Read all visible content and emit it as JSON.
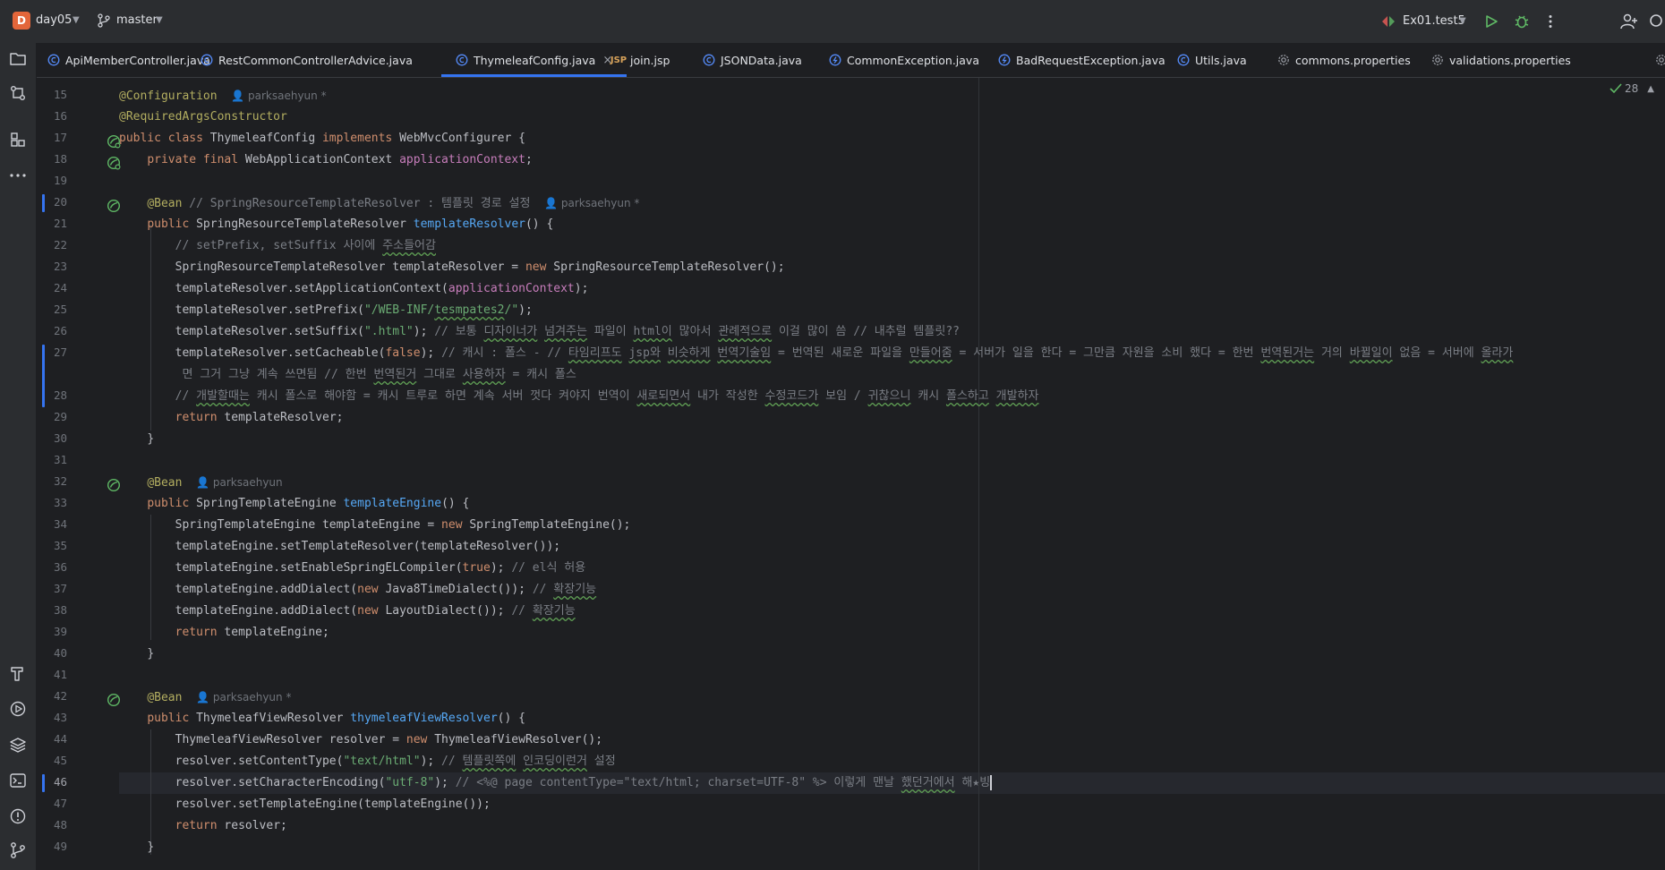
{
  "titlebar": {
    "project_initial": "D",
    "project_name": "day05",
    "branch": "master",
    "run_config": "Ex01.test5",
    "colors": {
      "accent": "#3574f0",
      "badge": "#e3663a",
      "run": "#5fb865"
    }
  },
  "left_toolbar": {
    "icons": [
      "folder-icon",
      "commit-icon",
      "structure-icon",
      "more-icon",
      "build-icon",
      "run-icon",
      "layers-icon",
      "terminal-icon",
      "problems-icon",
      "git-icon"
    ]
  },
  "tabs": [
    {
      "label": "ApiMemberController.java",
      "icon": "java-class-icon"
    },
    {
      "label": "RestCommonControllerAdvice.java",
      "icon": "java-class-icon"
    },
    {
      "label": "ThymeleafConfig.java",
      "icon": "java-class-icon",
      "active": true
    },
    {
      "label": "join.jsp",
      "icon": "jsp-icon"
    },
    {
      "label": "JSONData.java",
      "icon": "java-class-icon"
    },
    {
      "label": "CommonException.java",
      "icon": "exception-icon"
    },
    {
      "label": "BadRequestException.java",
      "icon": "exception-icon"
    },
    {
      "label": "Utils.java",
      "icon": "java-class-icon"
    },
    {
      "label": "commons.properties",
      "icon": "settings-icon"
    },
    {
      "label": "validations.properties",
      "icon": "settings-icon"
    }
  ],
  "tab_close_glyph": "×",
  "inspection": {
    "count": "28"
  },
  "gutter": {
    "line_numbers": [
      "15",
      "16",
      "17",
      "18",
      "19",
      "20",
      "21",
      "22",
      "23",
      "24",
      "25",
      "26",
      "27",
      "",
      "28",
      "29",
      "30",
      "31",
      "32",
      "33",
      "34",
      "35",
      "36",
      "37",
      "38",
      "39",
      "40",
      "41",
      "42",
      "43",
      "44",
      "45",
      "46",
      "47",
      "48",
      "49"
    ]
  },
  "code": {
    "l15_ann": "@Configuration",
    "l15_author": "parksaehyun *",
    "l16_ann": "@RequiredArgsConstructor",
    "l17_a": "public class ",
    "l17_b": "ThymeleafConfig ",
    "l17_c": "implements ",
    "l17_d": "WebMvcConfigurer {",
    "l18_a": "private final ",
    "l18_b": "WebApplicationContext ",
    "l18_c": "applicationContext",
    "l18_d": ";",
    "l20_ann": "@Bean",
    "l20_cm": " // SpringResourceTemplateResolver : 템플릿 경로 설정",
    "l20_author": "parksaehyun *",
    "l21_a": "public ",
    "l21_b": "SpringResourceTemplateResolver ",
    "l21_c": "templateResolver",
    "l21_d": "() {",
    "l22_cm1": "// setPrefix, setSuffix 사이에 ",
    "l22_cm2": "주소들어감",
    "l23_a": "SpringResourceTemplateResolver templateResolver = ",
    "l23_b": "new ",
    "l23_c": "SpringResourceTemplateResolver();",
    "l24_a": "templateResolver.setApplicationContext(",
    "l24_b": "applicationContext",
    "l24_c": ");",
    "l25_a": "templateResolver.setPrefix(",
    "l25_b": "\"/WEB-INF/",
    "l25_c": "tesmpates2",
    "l25_d": "/\"",
    "l25_e": ");",
    "l26_a": "templateResolver.setSuffix(",
    "l26_b": "\".html\"",
    "l26_c": "); ",
    "l26_d": "// 보통 ",
    "l26_e": "디자이너가",
    "l26_f": " ",
    "l26_g": "넘겨주는",
    "l26_h": " 파일이 ",
    "l26_i": "html이",
    "l26_j": " 많아서 ",
    "l26_k": "관례적으로",
    "l26_l": " 이걸 많이 씀 // 내추럴 템플릿??",
    "l27_a": "templateResolver.setCacheable(",
    "l27_b": "false",
    "l27_c": "); ",
    "l27_d": "// 캐시 : 폴스 - // ",
    "l27_e": "타임리프도",
    "l27_f": " ",
    "l27_g": "jsp와",
    "l27_h": " ",
    "l27_i": "비슷하게",
    "l27_j": " ",
    "l27_k": "번역기술임",
    "l27_l": " = 번역된 새로운 파일을 ",
    "l27_m": "만들어줌",
    "l27_n": " = 서버가 일을 한다 = 그만큼 자원을 소비 했다 = 한번 ",
    "l27_o": "번역된거는",
    "l27_p": " 거의 ",
    "l27_q": "바뀔일이",
    "l27_r": " 없음 = 서버에 ",
    "l27_s": "올라가",
    "l27w_a": " 면 그거 그냥 계속 쓰면됨 // 한번 ",
    "l27w_b": "번역된거",
    "l27w_c": " 그대로 ",
    "l27w_d": "사용하자",
    "l27w_e": " = 캐시 폴스",
    "l28_a": "// ",
    "l28_b": "개발할때는",
    "l28_c": " 캐시 폴스로 해야함 = 캐시 트루로 하면 계속 서버 껏다 켜야지 번역이 ",
    "l28_d": "새로되면서",
    "l28_e": " 내가 작성한 ",
    "l28_f": "수정코드가",
    "l28_g": " 보임 / ",
    "l28_h": "귀찮으니",
    "l28_i": " 캐시 ",
    "l28_j": "폴스하고",
    "l28_k": " ",
    "l28_l": "개발하자",
    "l29_a": "return ",
    "l29_b": "templateResolver;",
    "l30": "}",
    "l32_ann": "@Bean",
    "l32_author": "parksaehyun",
    "l33_a": "public ",
    "l33_b": "SpringTemplateEngine ",
    "l33_c": "templateEngine",
    "l33_d": "() {",
    "l34_a": "SpringTemplateEngine templateEngine = ",
    "l34_b": "new ",
    "l34_c": "SpringTemplateEngine();",
    "l35": "templateEngine.setTemplateResolver(templateResolver());",
    "l36_a": "templateEngine.setEnableSpringELCompiler(",
    "l36_b": "true",
    "l36_c": "); ",
    "l36_d": "// el식 허용",
    "l37_a": "templateEngine.addDialect(",
    "l37_b": "new ",
    "l37_c": "Java8TimeDialect()); ",
    "l37_d": "// ",
    "l37_e": "확장기능",
    "l38_a": "templateEngine.addDialect(",
    "l38_b": "new ",
    "l38_c": "LayoutDialect()); ",
    "l38_d": "// ",
    "l38_e": "확장기능",
    "l39_a": "return ",
    "l39_b": "templateEngine;",
    "l40": "}",
    "l42_ann": "@Bean",
    "l42_author": "parksaehyun *",
    "l43_a": "public ",
    "l43_b": "ThymeleafViewResolver ",
    "l43_c": "thymeleafViewResolver",
    "l43_d": "() {",
    "l44_a": "ThymeleafViewResolver resolver = ",
    "l44_b": "new ",
    "l44_c": "ThymeleafViewResolver();",
    "l45_a": "resolver.setContentType(",
    "l45_b": "\"text/html\"",
    "l45_c": "); ",
    "l45_d": "// ",
    "l45_e": "템플릿쪽에",
    "l45_f": " ",
    "l45_g": "인코딩이런거",
    "l45_h": " 설정",
    "l46_a": "resolver.setCharacterEncoding(",
    "l46_b": "\"utf-8\"",
    "l46_c": "); ",
    "l46_d": "// <%@ page contentType=\"text/html; charset=UTF-8\" %> 이렇게 맨날 ",
    "l46_e": "했던거에서",
    "l46_f": " 해★빙",
    "l47": "resolver.setTemplateEngine(templateEngine());",
    "l48_a": "return ",
    "l48_b": "resolver;",
    "l49": "}"
  }
}
